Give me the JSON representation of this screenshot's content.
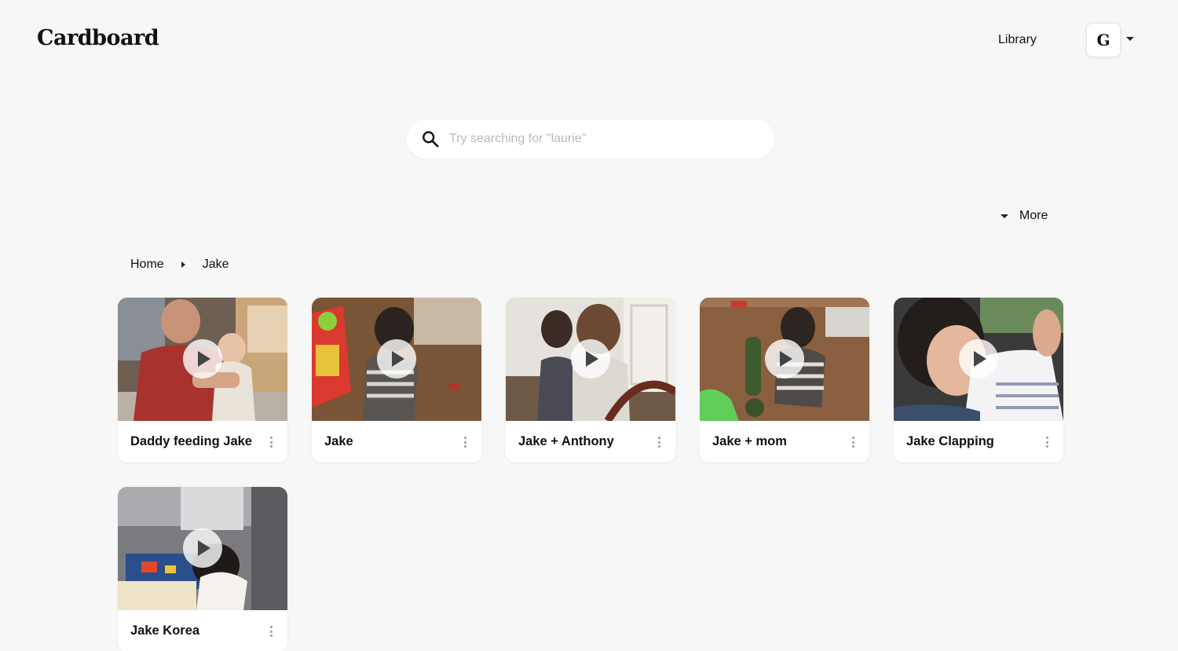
{
  "app": {
    "title": "Cardboard"
  },
  "header": {
    "library_label": "Library",
    "avatar_initial": "G"
  },
  "search": {
    "placeholder": "Try searching for \"laurie\"",
    "value": ""
  },
  "toolbar": {
    "more_label": "More"
  },
  "breadcrumb": {
    "items": [
      "Home",
      "Jake"
    ]
  },
  "videos": [
    {
      "title": "Daddy feeding Jake"
    },
    {
      "title": "Jake"
    },
    {
      "title": "Jake + Anthony"
    },
    {
      "title": "Jake + mom"
    },
    {
      "title": "Jake Clapping"
    },
    {
      "title": "Jake Korea"
    }
  ],
  "icons": {
    "search": "search-icon",
    "play": "play-icon",
    "menu": "kebab-menu-icon",
    "dropdown": "caret-down-icon",
    "separator": "caret-right-icon"
  }
}
